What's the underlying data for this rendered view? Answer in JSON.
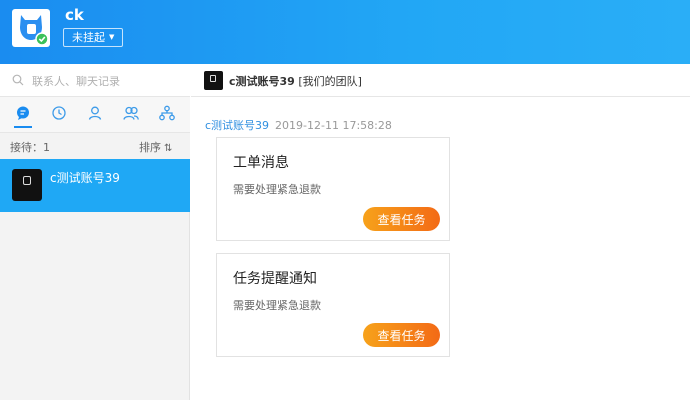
{
  "header": {
    "username": "ck",
    "status_label": "未挂起"
  },
  "sidebar": {
    "search_placeholder": "联系人、聊天记录",
    "queue_label": "接待：1",
    "sort_label": "排序",
    "contacts": [
      {
        "name": "c测试账号39"
      }
    ]
  },
  "chat": {
    "header": {
      "name": "c测试账号39",
      "team": "[我们的团队]"
    },
    "message": {
      "sender": "c测试账号39",
      "time": "2019-12-11 17:58:28"
    },
    "cards": [
      {
        "title": "工单消息",
        "desc": "需要处理紧急退款",
        "button": "查看任务"
      },
      {
        "title": "任务提醒通知",
        "desc": "需要处理紧急退款",
        "button": "查看任务"
      }
    ]
  },
  "colors": {
    "header_blue": "#1a8cf0",
    "selected_contact": "#1fa8f5",
    "button_orange": "#f36a16",
    "sender_link": "#2f8fe0"
  }
}
